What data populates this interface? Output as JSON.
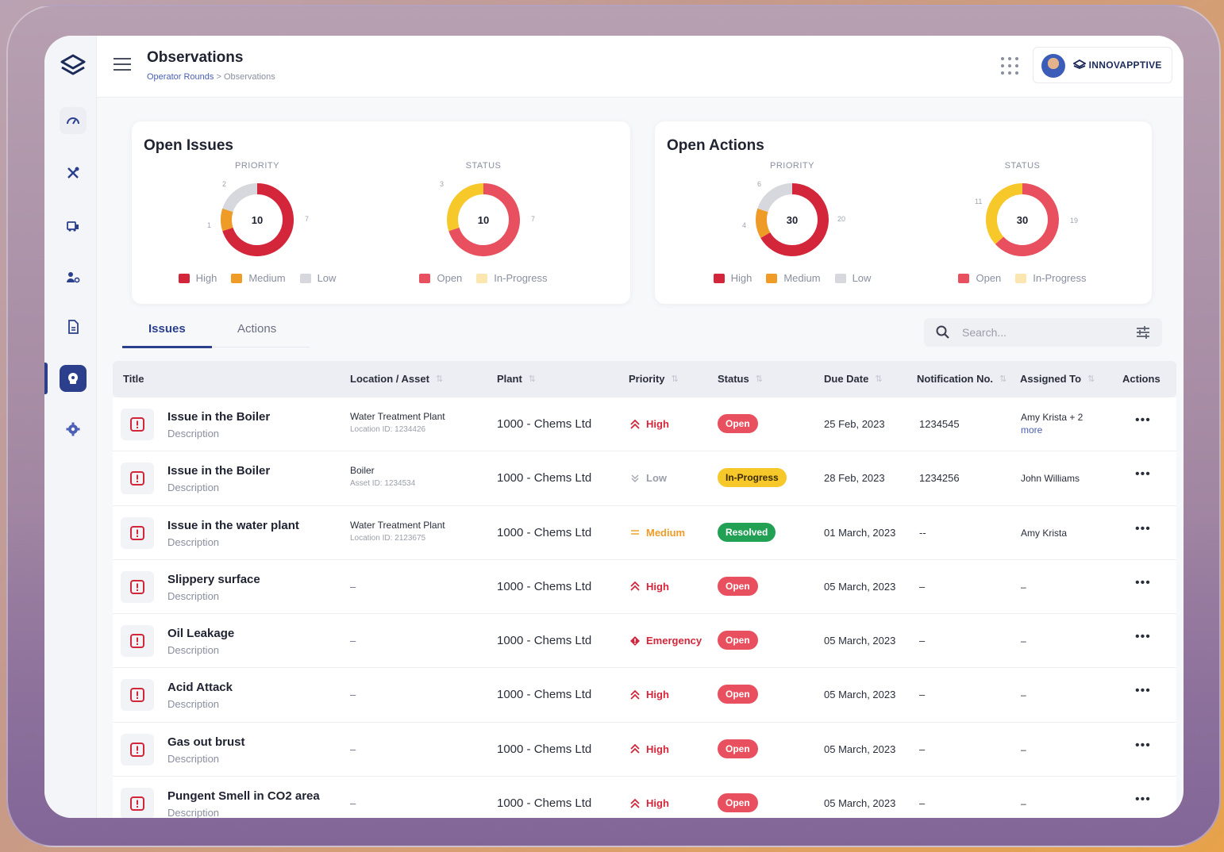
{
  "header": {
    "title": "Observations",
    "breadcrumb": {
      "parent": "Operator Rounds",
      "separator": ">",
      "current": "Observations"
    },
    "brand": "INNOVAPPTIVE"
  },
  "sidebar": {
    "items": [
      {
        "name": "dashboard-icon"
      },
      {
        "name": "tools-icon"
      },
      {
        "name": "equipment-icon"
      },
      {
        "name": "users-icon"
      },
      {
        "name": "document-icon"
      },
      {
        "name": "observations-icon",
        "active": true
      },
      {
        "name": "settings-icon"
      }
    ]
  },
  "open_issues": {
    "title": "Open Issues",
    "priority": {
      "caption": "PRIORITY",
      "total": "10",
      "values": {
        "high": 7,
        "medium": 1,
        "low": 2
      },
      "labels": {
        "high": "7",
        "medium": "1",
        "low": "2"
      }
    },
    "status": {
      "caption": "STATUS",
      "total": "10",
      "values": {
        "open": 7,
        "in_progress": 3
      },
      "labels": {
        "open": "7",
        "in_progress": "3"
      }
    }
  },
  "open_actions": {
    "title": "Open Actions",
    "priority": {
      "caption": "PRIORITY",
      "total": "30",
      "values": {
        "high": 20,
        "medium": 4,
        "low": 6
      },
      "labels": {
        "high": "20",
        "medium": "4",
        "low": "6"
      }
    },
    "status": {
      "caption": "STATUS",
      "total": "30",
      "values": {
        "open": 19,
        "in_progress": 11
      },
      "labels": {
        "open": "19",
        "in_progress": "11"
      }
    }
  },
  "legend": {
    "high": "High",
    "medium": "Medium",
    "low": "Low",
    "open": "Open",
    "in_progress": "In-Progress"
  },
  "colors": {
    "high": "#d4263a",
    "medium": "#ef9b27",
    "low": "#d6d8dd",
    "open": "#e9505f",
    "in_progress": "#f7c82a",
    "resolved": "#22a155",
    "primary": "#2b3f8c"
  },
  "tabs": {
    "issues": "Issues",
    "actions": "Actions"
  },
  "search": {
    "placeholder": "Search..."
  },
  "table": {
    "headers": [
      "Title",
      "Location / Asset",
      "Plant",
      "Priority",
      "Status",
      "Due Date",
      "Notification No.",
      "Assigned To",
      "Actions"
    ],
    "rows": [
      {
        "title": "Issue in the Boiler",
        "desc": "Description",
        "loc": "Water Treatment Plant",
        "loc_id": "Location ID: 1234426",
        "plant": "1000 - Chems Ltd",
        "priority": "High",
        "status": "Open",
        "due": "25 Feb, 2023",
        "notif": "1234545",
        "assigned": "Amy Krista + 2",
        "assigned_more": "more"
      },
      {
        "title": "Issue in the Boiler",
        "desc": "Description",
        "loc": "Boiler",
        "loc_id": "Asset ID: 1234534",
        "plant": "1000 - Chems Ltd",
        "priority": "Low",
        "status": "In-Progress",
        "due": "28 Feb, 2023",
        "notif": "1234256",
        "assigned": "John Williams"
      },
      {
        "title": "Issue in the water plant",
        "desc": "Description",
        "loc": "Water Treatment Plant",
        "loc_id": "Location ID: 2123675",
        "plant": "1000 - Chems Ltd",
        "priority": "Medium",
        "status": "Resolved",
        "due": "01 March, 2023",
        "notif": "--",
        "assigned": "Amy Krista"
      },
      {
        "title": "Slippery surface",
        "desc": "Description",
        "loc": "–",
        "plant": "1000 - Chems Ltd",
        "priority": "High",
        "status": "Open",
        "due": "05 March, 2023",
        "notif": "–",
        "assigned": "–"
      },
      {
        "title": "Oil Leakage",
        "desc": "Description",
        "loc": "–",
        "plant": "1000 - Chems Ltd",
        "priority": "Emergency",
        "status": "Open",
        "due": "05 March, 2023",
        "notif": "–",
        "assigned": "–"
      },
      {
        "title": "Acid Attack",
        "desc": "Description",
        "loc": "–",
        "plant": "1000 - Chems Ltd",
        "priority": "High",
        "status": "Open",
        "due": "05 March, 2023",
        "notif": "–",
        "assigned": "–"
      },
      {
        "title": "Gas out brust",
        "desc": "Description",
        "loc": "–",
        "plant": "1000 - Chems Ltd",
        "priority": "High",
        "status": "Open",
        "due": "05 March, 2023",
        "notif": "–",
        "assigned": "–"
      },
      {
        "title": "Pungent Smell in CO2 area",
        "desc": "Description",
        "loc": "–",
        "plant": "1000 - Chems Ltd",
        "priority": "High",
        "status": "Open",
        "due": "05 March, 2023",
        "notif": "–",
        "assigned": "–"
      }
    ]
  }
}
